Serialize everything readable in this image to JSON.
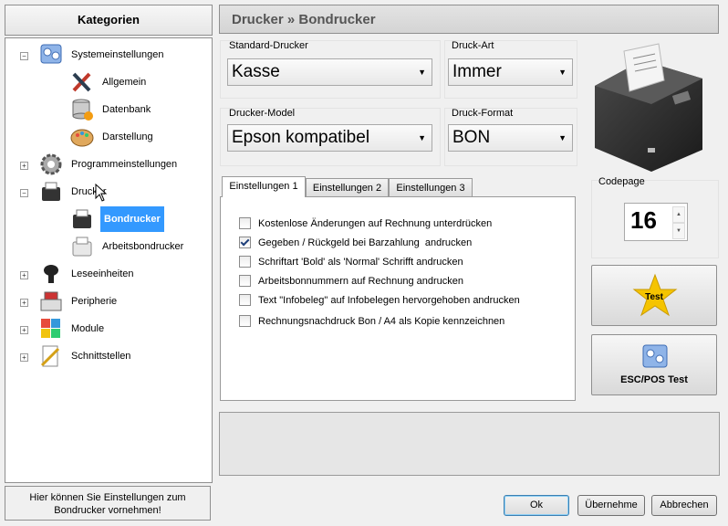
{
  "sidebar": {
    "header": "Kategorien",
    "items": [
      {
        "label": "Systemeinstellungen",
        "icon": "system-settings-icon",
        "expander": "−"
      },
      {
        "label": "Allgemein",
        "icon": "tools-icon"
      },
      {
        "label": "Datenbank",
        "icon": "database-icon"
      },
      {
        "label": "Darstellung",
        "icon": "palette-icon"
      },
      {
        "label": "Programmeinstellungen",
        "icon": "gear-icon",
        "expander": "+"
      },
      {
        "label": "Drucker",
        "icon": "printer-icon",
        "expander": "−"
      },
      {
        "label": "Bondrucker",
        "icon": "receipt-printer-icon",
        "selected": true
      },
      {
        "label": "Arbeitsbondrucker",
        "icon": "work-printer-icon"
      },
      {
        "label": "Leseeinheiten",
        "icon": "scanner-icon",
        "expander": "+"
      },
      {
        "label": "Peripherie",
        "icon": "cash-register-icon",
        "expander": "+"
      },
      {
        "label": "Module",
        "icon": "puzzle-icon",
        "expander": "+"
      },
      {
        "label": "Schnittstellen",
        "icon": "interface-icon",
        "expander": "+"
      }
    ],
    "footer": "Hier können Sie Einstellungen zum Bondrucker vornehmen!"
  },
  "header": {
    "title": "Drucker » Bondrucker"
  },
  "fields": {
    "standard_printer": {
      "label": "Standard-Drucker",
      "value": "Kasse"
    },
    "print_type": {
      "label": "Druck-Art",
      "value": "Immer"
    },
    "printer_model": {
      "label": "Drucker-Model",
      "value": "Epson kompatibel"
    },
    "print_format": {
      "label": "Druck-Format",
      "value": "BON"
    }
  },
  "tabs": [
    "Einstellungen 1",
    "Einstellungen 2",
    "Einstellungen 3"
  ],
  "options": [
    {
      "label": "Kostenlose Änderungen auf Rechnung unterdrücken",
      "checked": false
    },
    {
      "label": "Gegeben / Rückgeld bei Barzahlung  andrucken",
      "checked": true
    },
    {
      "label": "Schriftart 'Bold' als 'Normal' Schrifft andrucken",
      "checked": false
    },
    {
      "label": "Arbeitsbonnummern auf Rechnung andrucken",
      "checked": false
    },
    {
      "label": "Text \"Infobeleg\" auf Infobelegen hervorgehoben andrucken",
      "checked": false
    },
    {
      "label": "Rechnungsnachdruck Bon / A4 als Kopie kennzeichnen",
      "checked": false
    }
  ],
  "codepage": {
    "label": "Codepage",
    "value": "16"
  },
  "actions": {
    "test": "Test",
    "escpos": "ESC/POS Test"
  },
  "buttons": {
    "ok": "Ok",
    "apply": "Übernehme",
    "cancel": "Abbrechen"
  },
  "colors": {
    "selection": "#3399ff",
    "star": "#f5c400",
    "title_text": "#555555"
  }
}
